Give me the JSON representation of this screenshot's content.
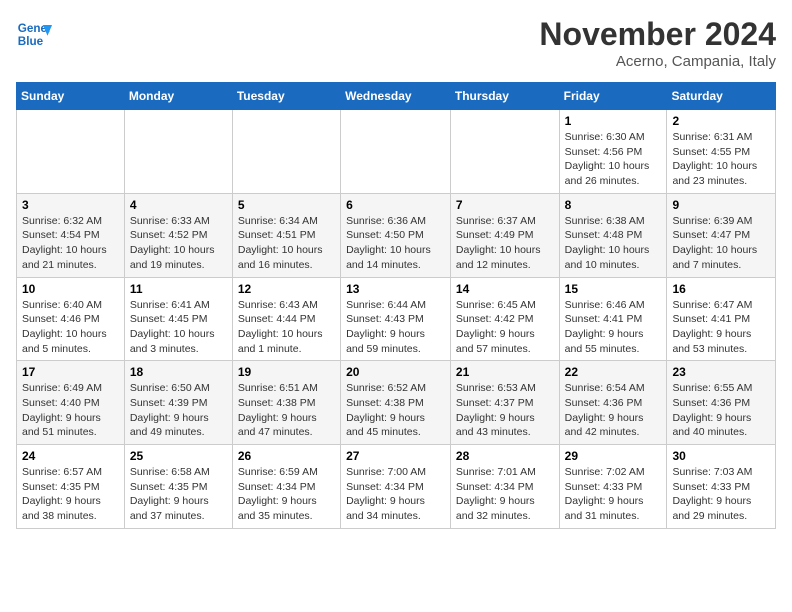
{
  "header": {
    "logo": {
      "line1": "General",
      "line2": "Blue"
    },
    "title": "November 2024",
    "location": "Acerno, Campania, Italy"
  },
  "days_of_week": [
    "Sunday",
    "Monday",
    "Tuesday",
    "Wednesday",
    "Thursday",
    "Friday",
    "Saturday"
  ],
  "weeks": [
    [
      {
        "day": "",
        "info": ""
      },
      {
        "day": "",
        "info": ""
      },
      {
        "day": "",
        "info": ""
      },
      {
        "day": "",
        "info": ""
      },
      {
        "day": "",
        "info": ""
      },
      {
        "day": "1",
        "info": "Sunrise: 6:30 AM\nSunset: 4:56 PM\nDaylight: 10 hours and 26 minutes."
      },
      {
        "day": "2",
        "info": "Sunrise: 6:31 AM\nSunset: 4:55 PM\nDaylight: 10 hours and 23 minutes."
      }
    ],
    [
      {
        "day": "3",
        "info": "Sunrise: 6:32 AM\nSunset: 4:54 PM\nDaylight: 10 hours and 21 minutes."
      },
      {
        "day": "4",
        "info": "Sunrise: 6:33 AM\nSunset: 4:52 PM\nDaylight: 10 hours and 19 minutes."
      },
      {
        "day": "5",
        "info": "Sunrise: 6:34 AM\nSunset: 4:51 PM\nDaylight: 10 hours and 16 minutes."
      },
      {
        "day": "6",
        "info": "Sunrise: 6:36 AM\nSunset: 4:50 PM\nDaylight: 10 hours and 14 minutes."
      },
      {
        "day": "7",
        "info": "Sunrise: 6:37 AM\nSunset: 4:49 PM\nDaylight: 10 hours and 12 minutes."
      },
      {
        "day": "8",
        "info": "Sunrise: 6:38 AM\nSunset: 4:48 PM\nDaylight: 10 hours and 10 minutes."
      },
      {
        "day": "9",
        "info": "Sunrise: 6:39 AM\nSunset: 4:47 PM\nDaylight: 10 hours and 7 minutes."
      }
    ],
    [
      {
        "day": "10",
        "info": "Sunrise: 6:40 AM\nSunset: 4:46 PM\nDaylight: 10 hours and 5 minutes."
      },
      {
        "day": "11",
        "info": "Sunrise: 6:41 AM\nSunset: 4:45 PM\nDaylight: 10 hours and 3 minutes."
      },
      {
        "day": "12",
        "info": "Sunrise: 6:43 AM\nSunset: 4:44 PM\nDaylight: 10 hours and 1 minute."
      },
      {
        "day": "13",
        "info": "Sunrise: 6:44 AM\nSunset: 4:43 PM\nDaylight: 9 hours and 59 minutes."
      },
      {
        "day": "14",
        "info": "Sunrise: 6:45 AM\nSunset: 4:42 PM\nDaylight: 9 hours and 57 minutes."
      },
      {
        "day": "15",
        "info": "Sunrise: 6:46 AM\nSunset: 4:41 PM\nDaylight: 9 hours and 55 minutes."
      },
      {
        "day": "16",
        "info": "Sunrise: 6:47 AM\nSunset: 4:41 PM\nDaylight: 9 hours and 53 minutes."
      }
    ],
    [
      {
        "day": "17",
        "info": "Sunrise: 6:49 AM\nSunset: 4:40 PM\nDaylight: 9 hours and 51 minutes."
      },
      {
        "day": "18",
        "info": "Sunrise: 6:50 AM\nSunset: 4:39 PM\nDaylight: 9 hours and 49 minutes."
      },
      {
        "day": "19",
        "info": "Sunrise: 6:51 AM\nSunset: 4:38 PM\nDaylight: 9 hours and 47 minutes."
      },
      {
        "day": "20",
        "info": "Sunrise: 6:52 AM\nSunset: 4:38 PM\nDaylight: 9 hours and 45 minutes."
      },
      {
        "day": "21",
        "info": "Sunrise: 6:53 AM\nSunset: 4:37 PM\nDaylight: 9 hours and 43 minutes."
      },
      {
        "day": "22",
        "info": "Sunrise: 6:54 AM\nSunset: 4:36 PM\nDaylight: 9 hours and 42 minutes."
      },
      {
        "day": "23",
        "info": "Sunrise: 6:55 AM\nSunset: 4:36 PM\nDaylight: 9 hours and 40 minutes."
      }
    ],
    [
      {
        "day": "24",
        "info": "Sunrise: 6:57 AM\nSunset: 4:35 PM\nDaylight: 9 hours and 38 minutes."
      },
      {
        "day": "25",
        "info": "Sunrise: 6:58 AM\nSunset: 4:35 PM\nDaylight: 9 hours and 37 minutes."
      },
      {
        "day": "26",
        "info": "Sunrise: 6:59 AM\nSunset: 4:34 PM\nDaylight: 9 hours and 35 minutes."
      },
      {
        "day": "27",
        "info": "Sunrise: 7:00 AM\nSunset: 4:34 PM\nDaylight: 9 hours and 34 minutes."
      },
      {
        "day": "28",
        "info": "Sunrise: 7:01 AM\nSunset: 4:34 PM\nDaylight: 9 hours and 32 minutes."
      },
      {
        "day": "29",
        "info": "Sunrise: 7:02 AM\nSunset: 4:33 PM\nDaylight: 9 hours and 31 minutes."
      },
      {
        "day": "30",
        "info": "Sunrise: 7:03 AM\nSunset: 4:33 PM\nDaylight: 9 hours and 29 minutes."
      }
    ]
  ]
}
